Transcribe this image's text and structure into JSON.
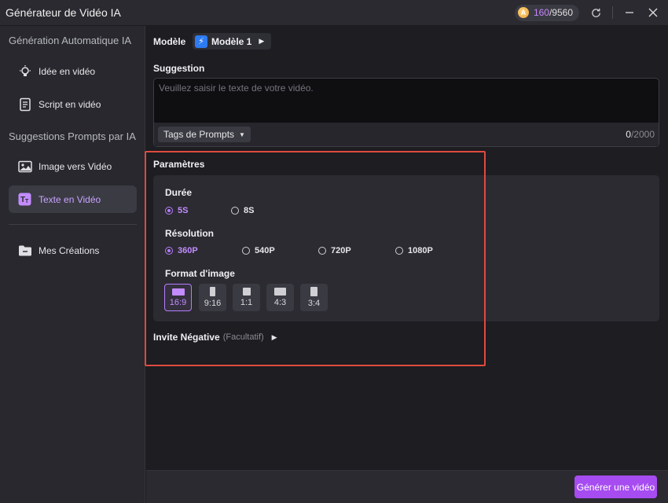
{
  "window": {
    "title": "Générateur de Vidéo IA",
    "credits_used": "160",
    "credits_total": "/9560"
  },
  "sidebar": {
    "section1": "Génération Automatique IA",
    "section2": "Suggestions Prompts par IA",
    "items": [
      {
        "label": "Idée en vidéo",
        "icon": "lightbulb-icon"
      },
      {
        "label": "Script en vidéo",
        "icon": "script-icon"
      },
      {
        "label": "Image vers Vidéo",
        "icon": "image-icon"
      },
      {
        "label": "Texte en Vidéo",
        "icon": "text-icon",
        "active": true
      },
      {
        "label": "Mes Créations",
        "icon": "folder-icon"
      }
    ]
  },
  "main": {
    "model_label": "Modèle",
    "model_value": "Modèle 1",
    "suggestion_label": "Suggestion",
    "prompt_placeholder": "Veuillez saisir le texte de votre vidéo.",
    "tags_button": "Tags de Prompts",
    "char_count": "0",
    "char_max": "/2000",
    "params_label": "Paramètres",
    "duration_label": "Durée",
    "durations": [
      "5S",
      "8S"
    ],
    "selected_duration": "5S",
    "resolution_label": "Résolution",
    "resolutions": [
      "360P",
      "540P",
      "720P",
      "1080P"
    ],
    "selected_resolution": "360P",
    "format_label": "Format d'image",
    "formats": [
      "16:9",
      "9:16",
      "1:1",
      "4:3",
      "3:4"
    ],
    "selected_format": "16:9",
    "negative_label": "Invite Négative",
    "negative_optional": "(Facultatif)",
    "generate_button": "Générer une vidéo"
  },
  "colors": {
    "accent": "#a64cf0",
    "accent_text": "#c28cff",
    "highlight_border": "#e04a3f"
  }
}
